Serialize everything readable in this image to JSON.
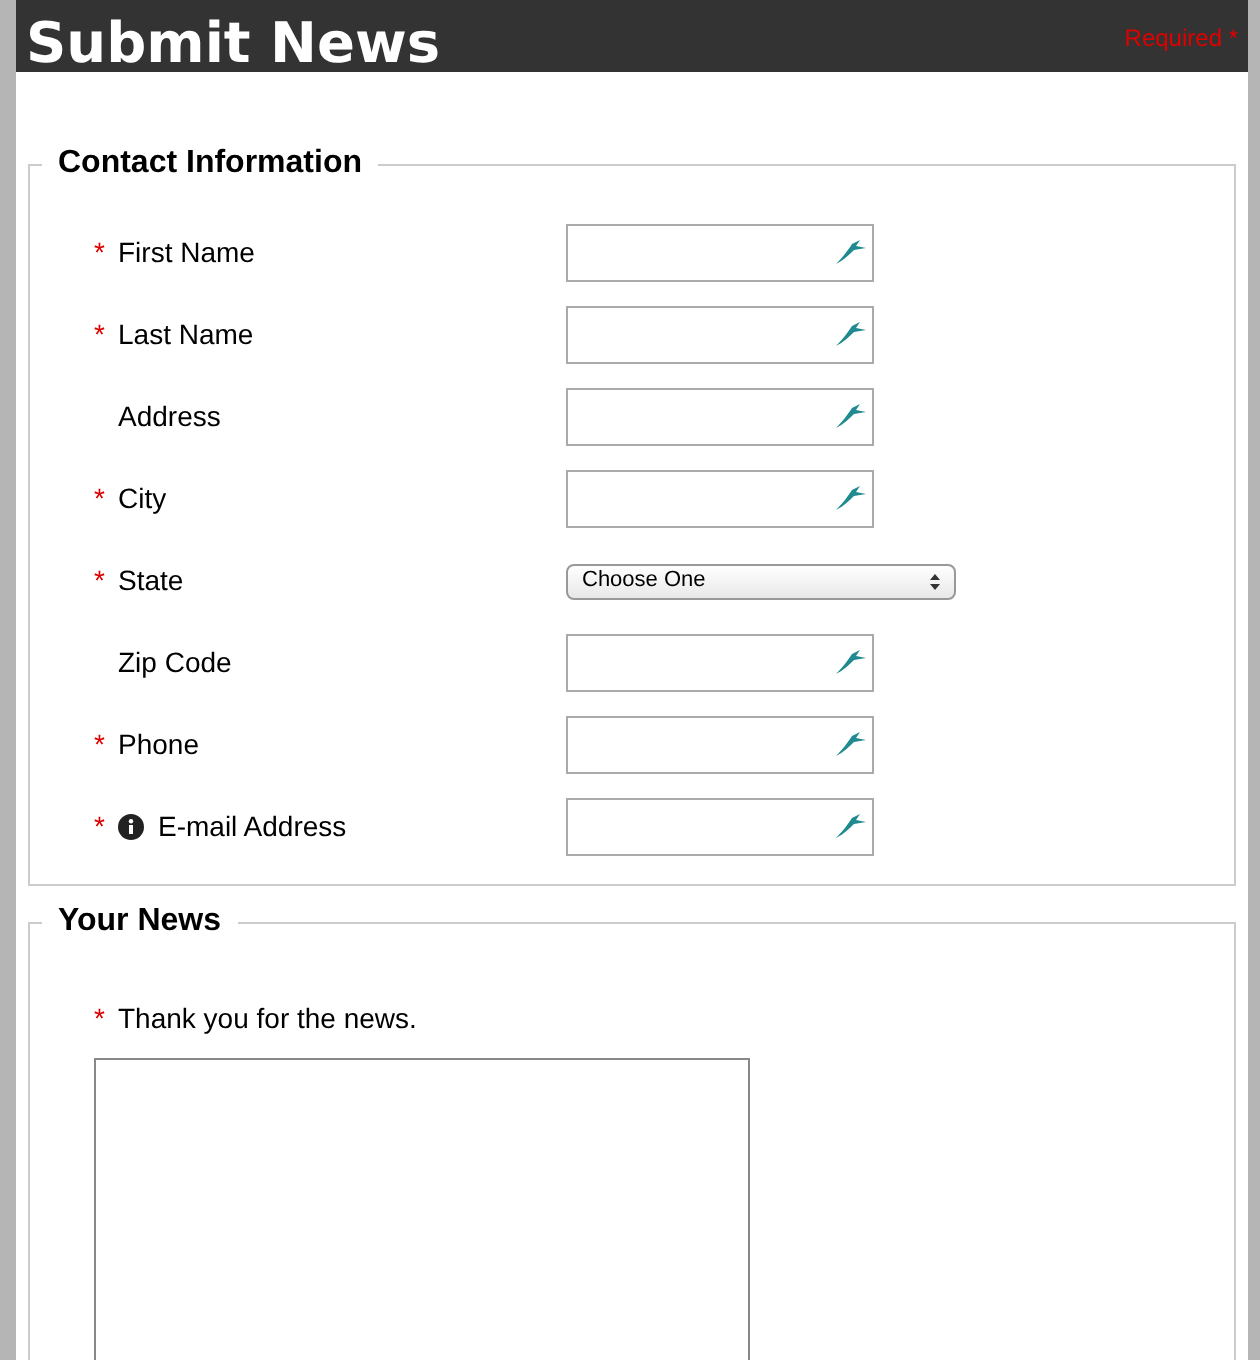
{
  "header": {
    "title": "Submit News",
    "required_note": "Required *"
  },
  "contact": {
    "legend": "Contact Information",
    "fields": [
      {
        "label": "First Name",
        "mark": "*",
        "info": false,
        "kind": "text"
      },
      {
        "label": "Last Name",
        "mark": "*",
        "info": false,
        "kind": "text"
      },
      {
        "label": "Address",
        "info": false,
        "kind": "text"
      },
      {
        "label": "City",
        "mark": "*",
        "info": false,
        "kind": "text"
      },
      {
        "label": "State",
        "mark": "*",
        "info": false,
        "kind": "select",
        "value": "Choose One"
      },
      {
        "label": "Zip Code",
        "info": false,
        "kind": "text"
      },
      {
        "label": "Phone",
        "mark": "*",
        "info": false,
        "kind": "text"
      },
      {
        "label": "E-mail Address",
        "mark": "*",
        "info": true,
        "kind": "text"
      }
    ]
  },
  "news": {
    "legend": "Your News",
    "label": "Thank you for the news.",
    "mark": "*"
  }
}
